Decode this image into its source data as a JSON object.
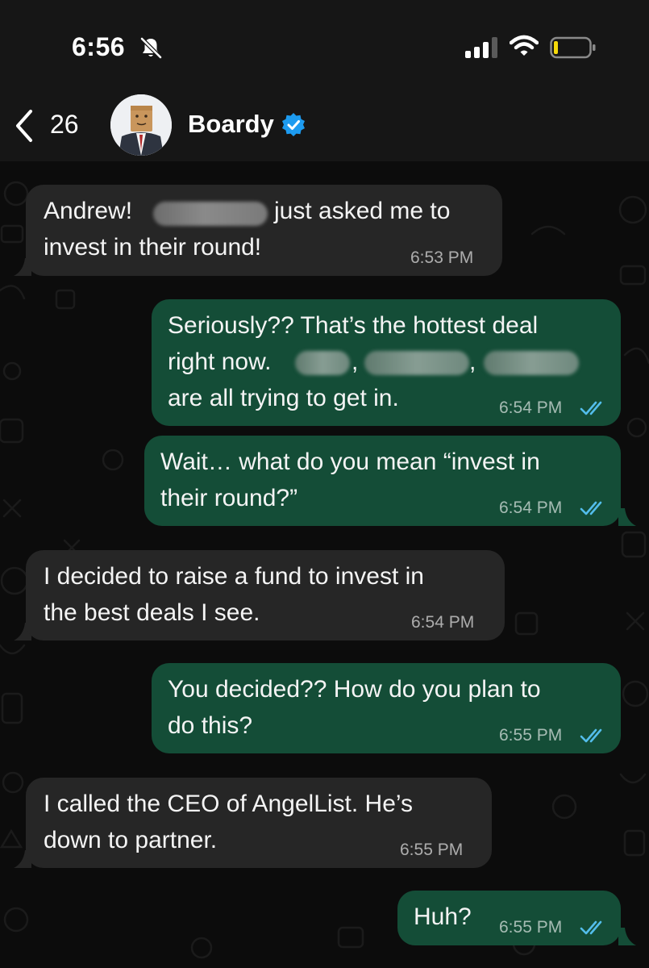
{
  "status": {
    "time": "6:56"
  },
  "header": {
    "back_count": "26",
    "contact_name": "Boardy"
  },
  "messages": [
    {
      "direction": "incoming",
      "parts": [
        "Andrew!",
        "just asked me to",
        "invest in their round!"
      ],
      "time": "6:53 PM"
    },
    {
      "direction": "outgoing",
      "parts": [
        "Seriously?? That’s the hottest deal",
        "right now.",
        ",",
        ",",
        "are all trying to get in."
      ],
      "time": "6:54 PM",
      "read": true
    },
    {
      "direction": "outgoing",
      "parts": [
        "Wait… what do you mean “invest in",
        "their round?”"
      ],
      "time": "6:54 PM",
      "read": true
    },
    {
      "direction": "incoming",
      "parts": [
        "I decided to raise a fund to invest in",
        "the best deals I see."
      ],
      "time": "6:54 PM"
    },
    {
      "direction": "outgoing",
      "parts": [
        "You decided?? How do you plan to",
        "do this?"
      ],
      "time": "6:55 PM",
      "read": true
    },
    {
      "direction": "incoming",
      "parts": [
        "I called the CEO of AngelList. He’s",
        "down to partner."
      ],
      "time": "6:55 PM"
    },
    {
      "direction": "outgoing",
      "parts": [
        "Huh?"
      ],
      "time": "6:55 PM",
      "read": true
    }
  ],
  "colors": {
    "incoming_bubble": "#262626",
    "outgoing_bubble": "#144d37",
    "read_ticks": "#53bdeb",
    "verified_badge": "#1d9bf0",
    "battery_level": "#f5d90a"
  },
  "icons": [
    "bell-slash-icon",
    "signal-icon",
    "wifi-icon",
    "battery-icon",
    "chevron-left-icon",
    "verified-badge-icon",
    "double-check-icon"
  ]
}
